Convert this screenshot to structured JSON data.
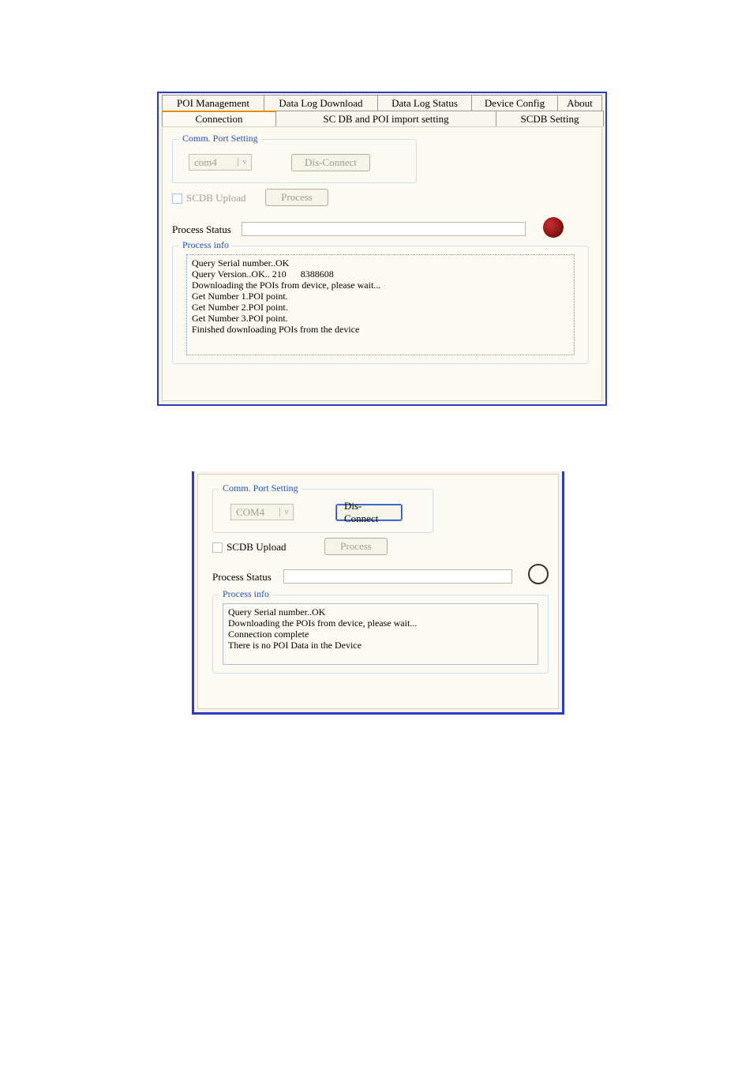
{
  "win1": {
    "tabs_top": [
      "POI Management",
      "Data Log Download",
      "Data Log Status",
      "Device Config",
      "About"
    ],
    "tabs_bottom": [
      "Connection",
      "SC DB and POI import setting",
      "SCDB  Setting"
    ],
    "group_comm": "Comm. Port Setting",
    "combo_value": "com4",
    "btn_disconnect": "Dis-Connect",
    "chk_scdb": "SCDB Upload",
    "btn_process": "Process",
    "lbl_status": "Process Status",
    "group_info": "Process info",
    "log": "Query Serial number..OK\nQuery Version..OK.. 210      8388608\nDownloading the POIs from device, please wait...\nGet Number 1.POI point.\nGet Number 2.POI point.\nGet Number 3.POI point.\nFinished downloading POIs from the device"
  },
  "win2": {
    "group_comm": "Comm. Port Setting",
    "combo_value": "COM4",
    "btn_disconnect": "Dis-Connect",
    "chk_scdb": "SCDB Upload",
    "btn_process": "Process",
    "lbl_status": "Process Status",
    "group_info": "Process info",
    "log": "Query Serial number..OK\nDownloading the POIs from device, please wait...\nConnection complete\nThere is no POI Data in the Device"
  }
}
